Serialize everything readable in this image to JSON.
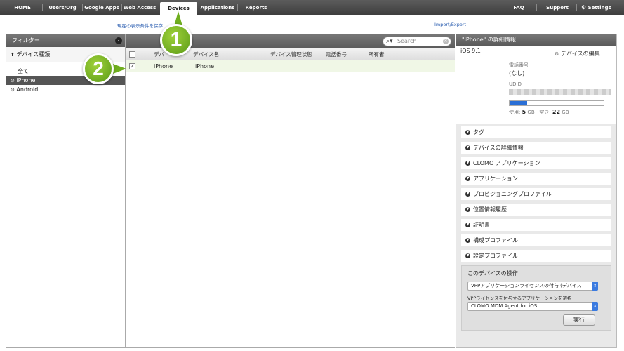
{
  "nav": {
    "home": "HOME",
    "users": "Users/Org",
    "google_apps": "Google Apps",
    "web_access": "Web Access",
    "devices": "Devices",
    "applications": "Applications",
    "reports": "Reports",
    "faq": "FAQ",
    "support": "Support",
    "settings": "Settings"
  },
  "subbar": {
    "save_filter": "現在の表示条件を保存",
    "import_export": "Import/Export"
  },
  "filter": {
    "title": "フィルター",
    "section": "デバイス種類",
    "items": [
      "全て",
      "iPhone",
      "Android"
    ],
    "selected": "iPhone"
  },
  "devices": {
    "search_placeholder": "Search",
    "columns": [
      "デバ",
      "デバイス名",
      "デバイス管理状態",
      "電話番号",
      "所有者"
    ],
    "rows": [
      {
        "type": "iPhone",
        "name": "iPhone",
        "status": "",
        "phone": "",
        "owner": "",
        "checked": true
      }
    ]
  },
  "detail": {
    "title": "\"iPhone\" の詳細情報",
    "os": "iOS 9.1",
    "edit_link": "デバイスの編集",
    "phone_label": "電話番号",
    "phone_value": "(なし)",
    "udid_label": "UDID",
    "storage_used_label": "使用:",
    "storage_used_value": "5",
    "storage_free_label": "空き:",
    "storage_free_value": "22",
    "storage_unit": "GB",
    "storage_used_fraction": 0.185,
    "accordion": [
      "タグ",
      "デバイスの詳細情報",
      "CLOMO アプリケーション",
      "アプリケーション",
      "プロビジョニングプロファイル",
      "位置情報履歴",
      "証明書",
      "構成プロファイル",
      "設定プロファイル"
    ],
    "operations_title": "このデバイスの操作",
    "operation_select": "VPPアプリケーションライセンスの付与 (デバイス",
    "app_select_label": "VPPライセンスを付与するアプリケーションを選択",
    "app_select": "CLOMO MDM Agent for iOS",
    "exec_button": "実行"
  },
  "callouts": [
    "1",
    "2"
  ]
}
